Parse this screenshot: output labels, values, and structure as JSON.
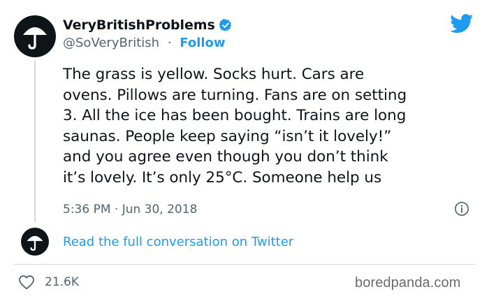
{
  "author": {
    "display_name": "VeryBritishProblems",
    "handle": "@SoVeryBritish",
    "separator": "·",
    "follow_label": "Follow",
    "avatar_icon": "umbrella-icon",
    "verified_icon": "verified-badge-icon"
  },
  "tweet": {
    "text_lines": [
      "The grass is yellow. Socks hurt. Cars are",
      "ovens. Pillows are turning. Fans are on setting",
      "3. All the ice has been bought. Trains are long",
      "saunas. People keep saying “isn’t it lovely!”",
      "and you agree even though you don’t think",
      "it’s lovely. It’s only 25°C. Someone help us"
    ],
    "timestamp": "5:36 PM · Jun 30, 2018"
  },
  "conversation_link": "Read the full conversation on Twitter",
  "engagement": {
    "likes": "21.6K",
    "like_icon": "heart-icon"
  },
  "watermark": "boredpanda.com",
  "colors": {
    "accent": "#1d9bf0",
    "text": "#0f1419",
    "muted": "#536471",
    "divider": "#cfd9de"
  }
}
